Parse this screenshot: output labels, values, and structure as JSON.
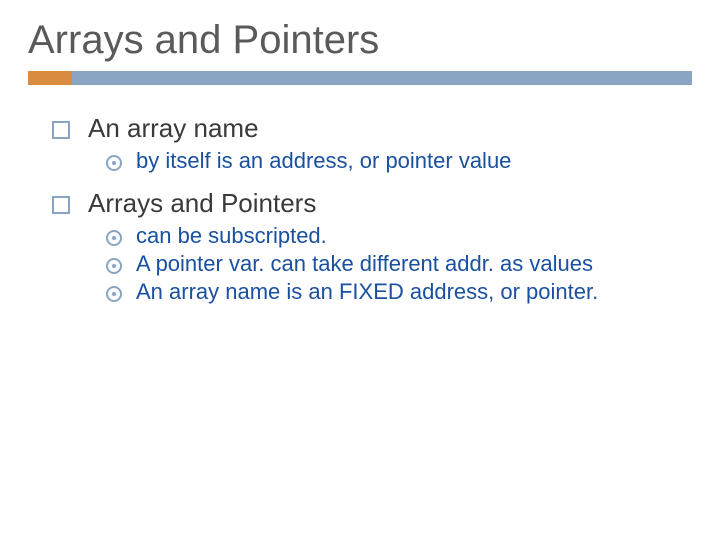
{
  "title": "Arrays and Pointers",
  "points": [
    {
      "label": "An array name",
      "sub": [
        "by itself is an address, or pointer value"
      ]
    },
    {
      "label": "Arrays and Pointers",
      "sub": [
        "can be subscripted.",
        "A pointer var. can take different addr. as values",
        "An array name is an FIXED address, or pointer."
      ]
    }
  ]
}
